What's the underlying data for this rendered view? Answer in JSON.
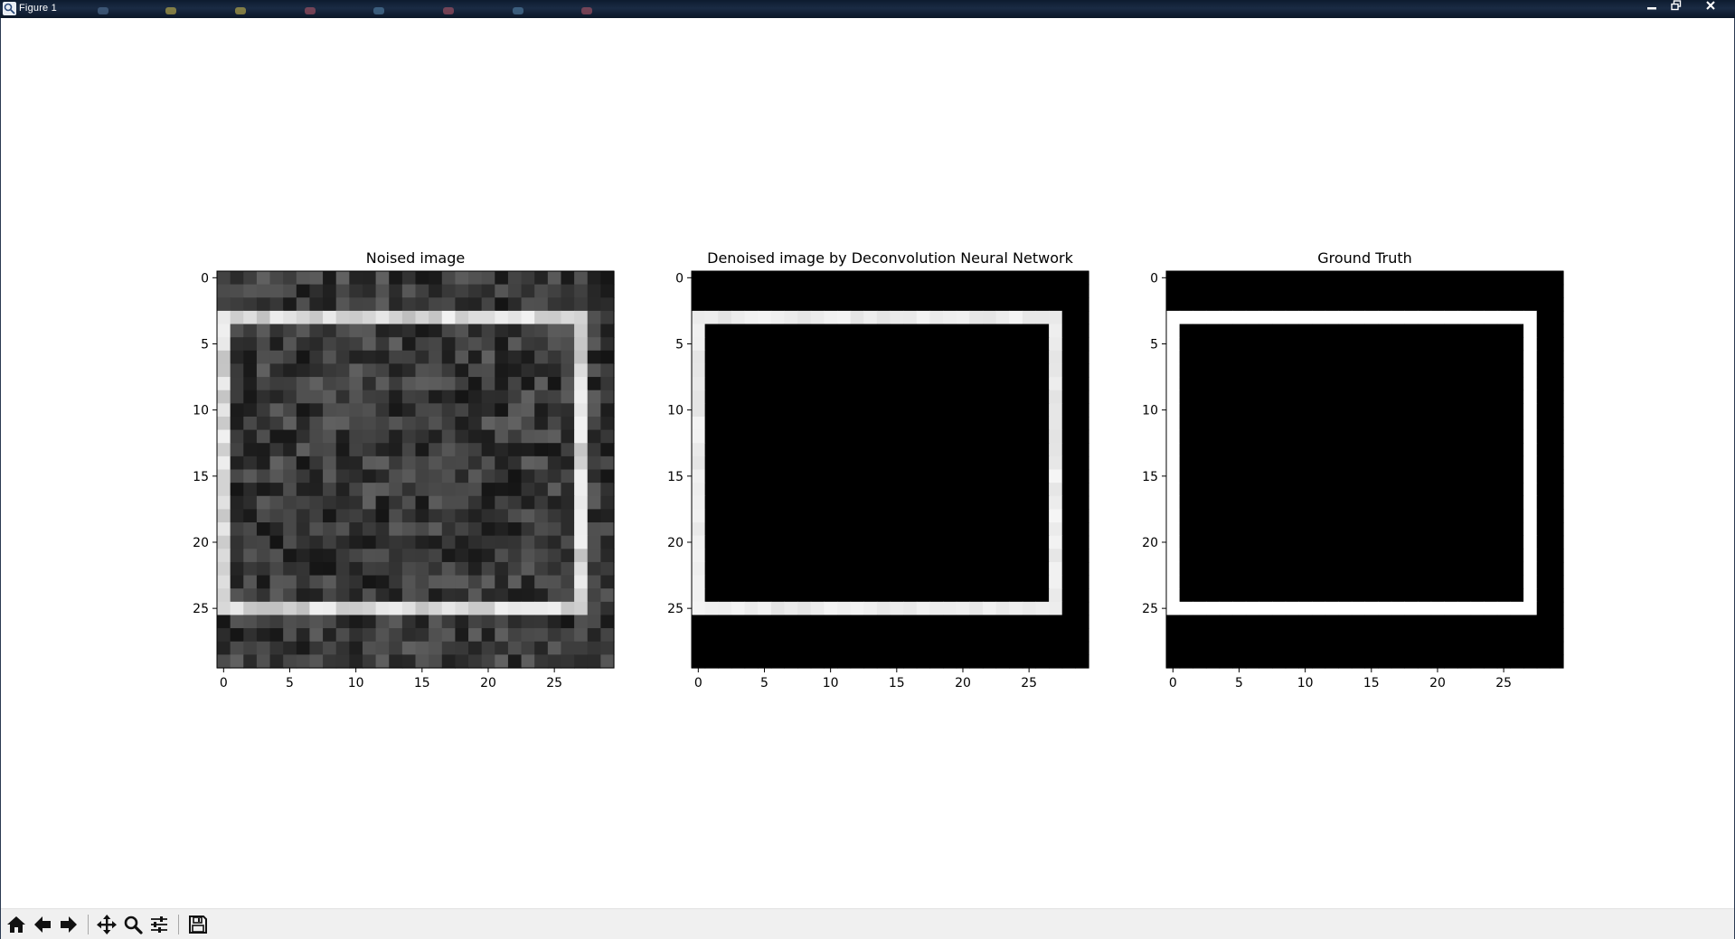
{
  "window": {
    "title": "Figure 1",
    "controls": [
      "minimize",
      "restore",
      "close"
    ]
  },
  "toolbar": {
    "buttons": [
      {
        "name": "home",
        "icon": "home-icon"
      },
      {
        "name": "back",
        "icon": "arrow-left-icon"
      },
      {
        "name": "forward",
        "icon": "arrow-right-icon"
      },
      {
        "name": "pan",
        "icon": "move-icon"
      },
      {
        "name": "zoom",
        "icon": "magnifier-icon"
      },
      {
        "name": "configure-subplots",
        "icon": "sliders-icon"
      },
      {
        "name": "save",
        "icon": "floppy-disk-icon"
      }
    ]
  },
  "chart_data": [
    {
      "type": "heatmap",
      "title": "Noised image",
      "colormap": "gray",
      "shape": [
        30,
        30
      ],
      "xlim": [
        -0.5,
        29.5
      ],
      "ylim": [
        29.5,
        -0.5
      ],
      "xticks": [
        0,
        5,
        10,
        15,
        20,
        25
      ],
      "yticks": [
        0,
        5,
        10,
        15,
        20,
        25
      ],
      "rectangle": {
        "rows": [
          3,
          25
        ],
        "cols": [
          0,
          27
        ],
        "border_value": 0.87
      },
      "background": "random noise, values 0.05–0.35"
    },
    {
      "type": "heatmap",
      "title": "Denoised image by Deconvolution Neural Network",
      "colormap": "gray",
      "shape": [
        30,
        30
      ],
      "xlim": [
        -0.5,
        29.5
      ],
      "ylim": [
        29.5,
        -0.5
      ],
      "xticks": [
        0,
        5,
        10,
        15,
        20,
        25
      ],
      "yticks": [
        0,
        5,
        10,
        15,
        20,
        25
      ],
      "rectangle": {
        "rows": [
          3,
          25
        ],
        "cols": [
          0,
          27
        ],
        "border_value": 0.93
      },
      "background": "uniform 0"
    },
    {
      "type": "heatmap",
      "title": "Ground Truth",
      "colormap": "gray",
      "shape": [
        30,
        30
      ],
      "xlim": [
        -0.5,
        29.5
      ],
      "ylim": [
        29.5,
        -0.5
      ],
      "xticks": [
        0,
        5,
        10,
        15,
        20,
        25
      ],
      "yticks": [
        0,
        5,
        10,
        15,
        20,
        25
      ],
      "rectangle": {
        "rows": [
          3,
          25
        ],
        "cols": [
          0,
          27
        ],
        "border_value": 1.0
      },
      "background": "uniform 0"
    }
  ]
}
